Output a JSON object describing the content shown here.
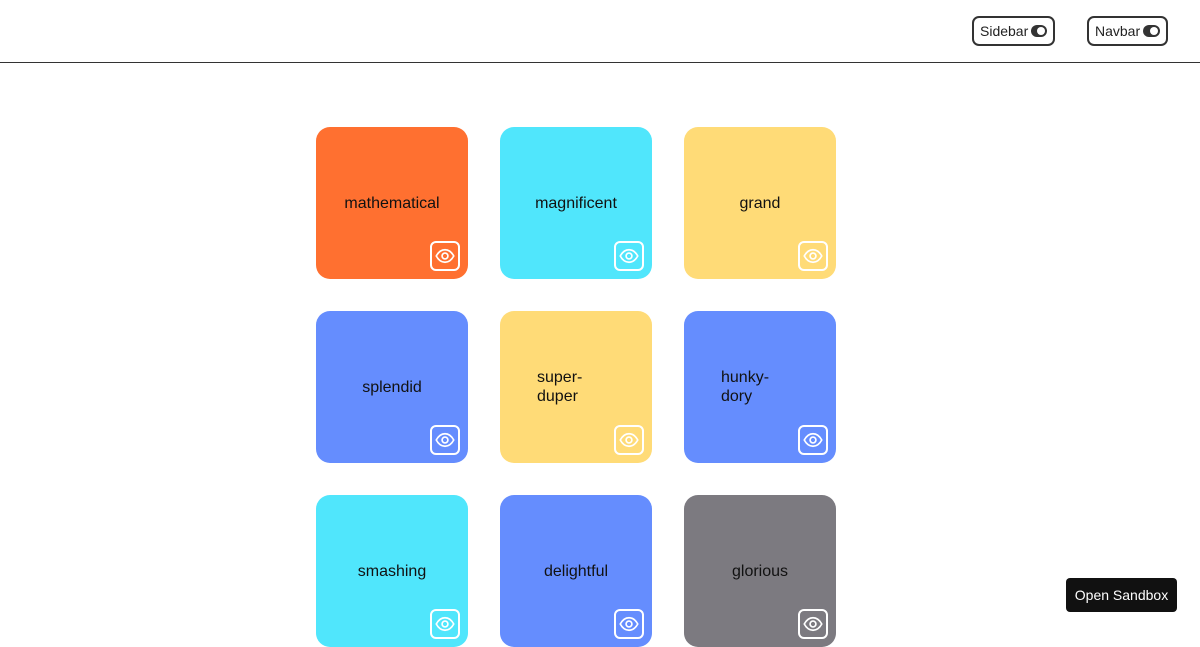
{
  "topbar": {
    "sidebar_toggle": {
      "label": "Sidebar",
      "on": true
    },
    "navbar_toggle": {
      "label": "Navbar",
      "on": true
    }
  },
  "cards": [
    {
      "label": "mathematical",
      "color": "#FF7030",
      "icon": "eye-icon"
    },
    {
      "label": "magnificent",
      "color": "#50E6FC",
      "icon": "eye-icon"
    },
    {
      "label": "grand",
      "color": "#FFDB77",
      "icon": "eye-icon"
    },
    {
      "label": "splendid",
      "color": "#658DFE",
      "icon": "eye-icon"
    },
    {
      "label": "super-duper",
      "color": "#FFDB77",
      "icon": "eye-icon"
    },
    {
      "label": "hunky-dory",
      "color": "#658DFE",
      "icon": "eye-icon"
    },
    {
      "label": "smashing",
      "color": "#50E6FC",
      "icon": "eye-icon"
    },
    {
      "label": "delightful",
      "color": "#658DFE",
      "icon": "eye-icon"
    },
    {
      "label": "glorious",
      "color": "#7C7A80",
      "icon": "eye-icon"
    }
  ],
  "sandbox": {
    "label": "Open Sandbox"
  }
}
